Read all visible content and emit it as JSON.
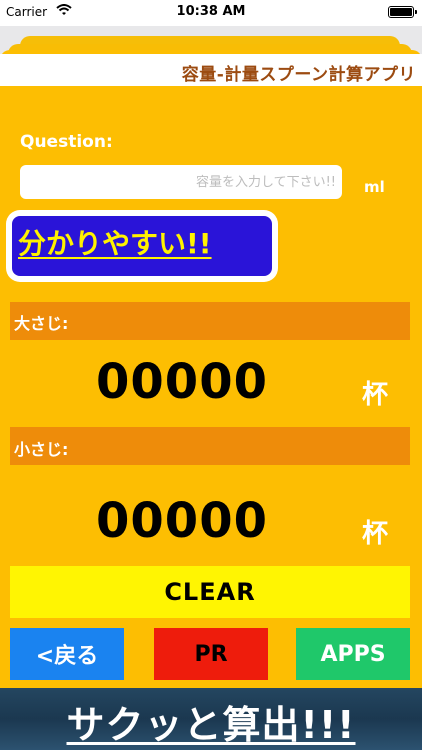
{
  "status_bar": {
    "carrier": "Carrier",
    "time": "10:38 AM"
  },
  "header": {
    "title": "容量-計量スプーン計算アプリ"
  },
  "question": {
    "label": "Question:",
    "placeholder": "容量を入力して下さい!!",
    "unit": "ml"
  },
  "promo": {
    "text": "分かりやすい!!"
  },
  "tablespoon": {
    "label": "大さじ:",
    "value": "00000",
    "unit": "杯"
  },
  "teaspoon": {
    "label": "小さじ:",
    "value": "00000",
    "unit": "杯"
  },
  "buttons": {
    "clear": "CLEAR",
    "back": "<戻る",
    "pr": "PR",
    "apps": "APPS"
  },
  "banner": {
    "text": "サクッと算出!!!"
  },
  "colors": {
    "background_yellow": "#fdbe02",
    "section_orange": "#ee8c0a",
    "clear_yellow": "#fff502",
    "back_blue": "#1a83f0",
    "pr_red": "#ee1c0c",
    "apps_green": "#1fc86a",
    "promo_blue": "#2a14d8",
    "title_brown": "#9c4b11"
  }
}
